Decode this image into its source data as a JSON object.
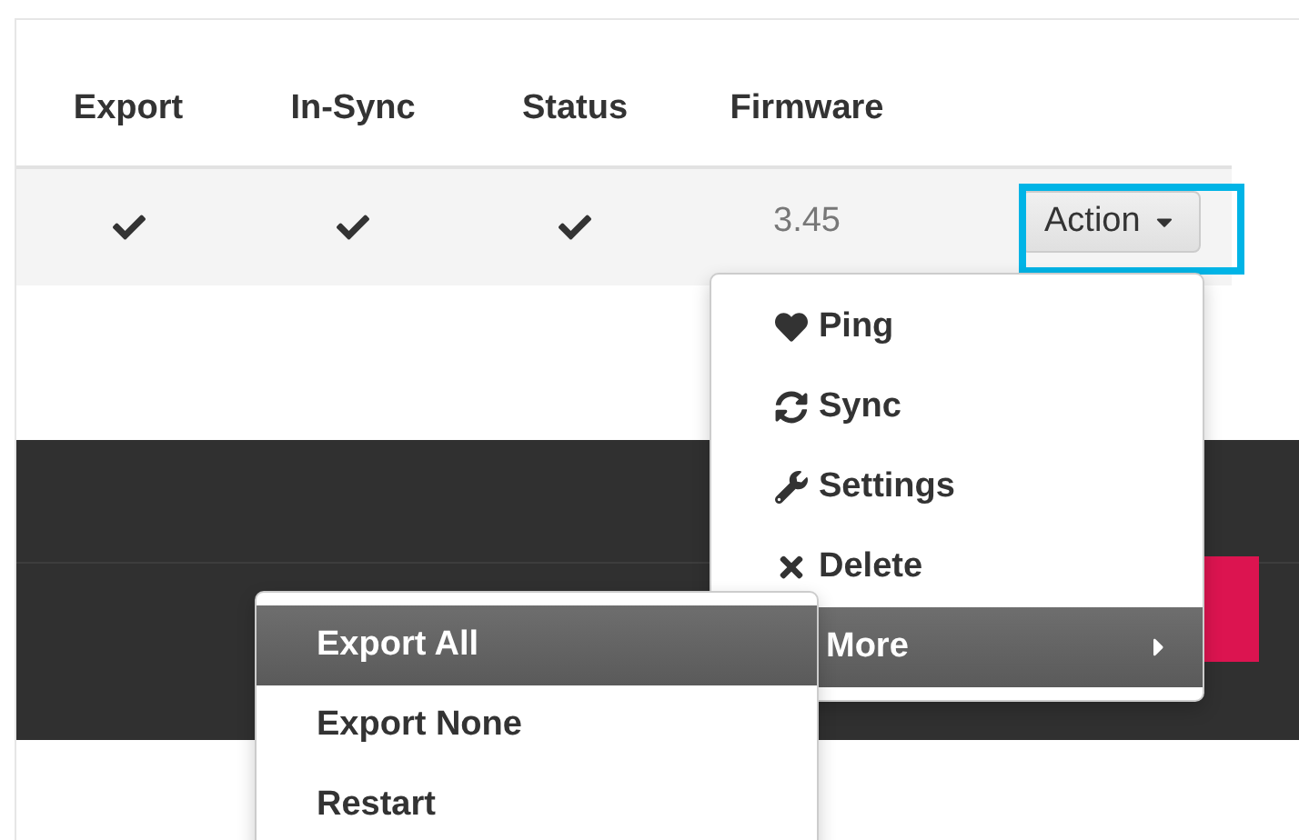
{
  "table": {
    "columns": [
      "Export",
      "In-Sync",
      "Status",
      "Firmware"
    ],
    "rows": [
      {
        "export": true,
        "in_sync": true,
        "status": true,
        "firmware": "3.45",
        "action": "Action"
      }
    ]
  },
  "menu": {
    "items": [
      {
        "label": "Ping",
        "kind": "action",
        "selected": false
      },
      {
        "label": "Sync",
        "kind": "action",
        "selected": false
      },
      {
        "label": "Settings",
        "kind": "action",
        "selected": false
      },
      {
        "label": "Delete",
        "kind": "action",
        "selected": false
      },
      {
        "label": "More",
        "kind": "submenu",
        "selected": true
      }
    ]
  },
  "submenu": {
    "items": [
      {
        "label": "Export All",
        "selected": true
      },
      {
        "label": "Export None",
        "selected": false
      },
      {
        "label": "Restart",
        "selected": false
      }
    ]
  }
}
